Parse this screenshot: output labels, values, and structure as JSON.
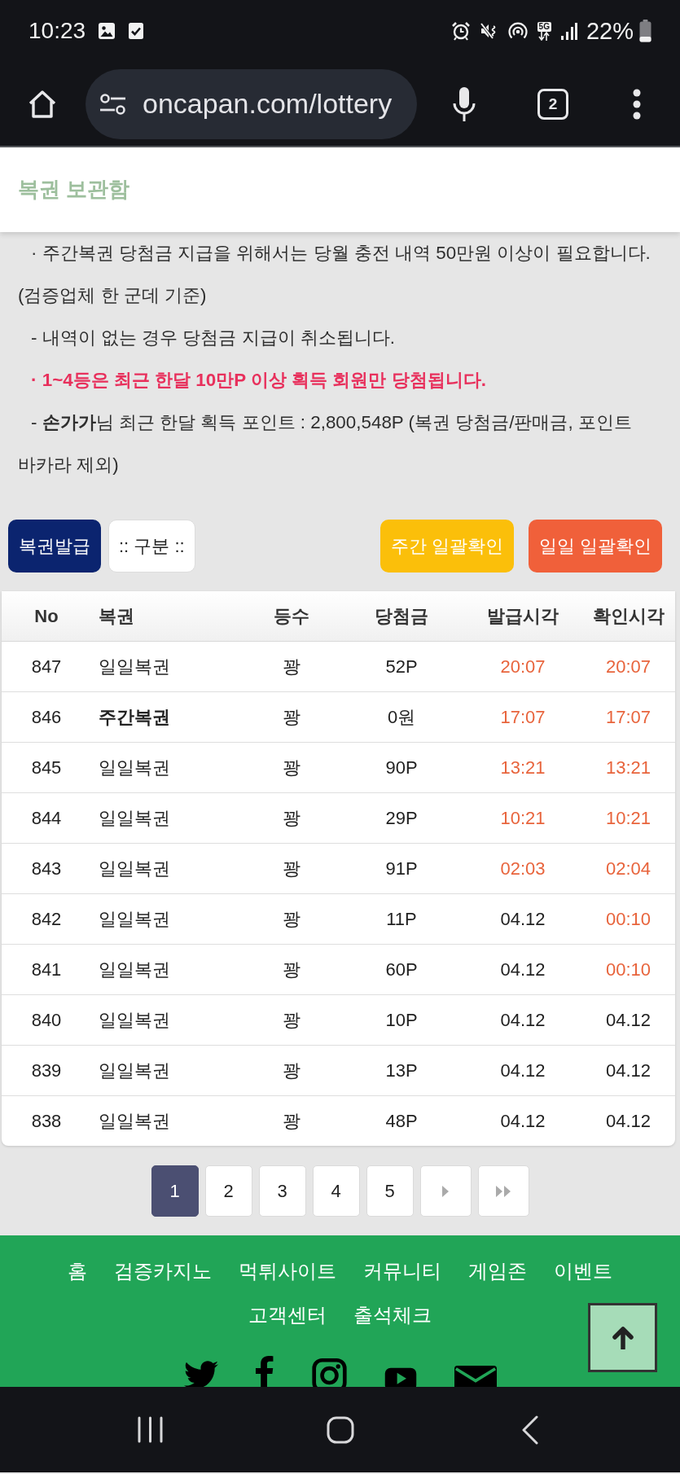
{
  "status_bar": {
    "time": "10:23",
    "network": "5G",
    "battery": "22%"
  },
  "browser": {
    "url": "oncapan.com/lottery",
    "tab_count": "2"
  },
  "header": {
    "title": "복권 보관함"
  },
  "notices": [
    {
      "text": "· 주간복권 당첨금 지급을 위해서는 당월 충전 내역 50만원 이상이 필요합니다. (검증업체 한 군데 기준)",
      "highlight": false
    },
    {
      "text": "- 내역이 없는 경우 당첨금 지급이 취소됩니다.",
      "highlight": false
    },
    {
      "text": "· 1~4등은 최근 한달 10만P 이상 획득 회원만 당첨됩니다.",
      "highlight": true
    },
    {
      "text": "- **손가가**님 최근 한달 획득 포인트 : 2,800,548P (복권 당첨금/판매금, 포인트 바카라 제외)",
      "highlight": false
    }
  ],
  "toolbar": {
    "left": [
      {
        "label": "복권발급",
        "kind": "issue"
      },
      {
        "label": ":: 구분 ::",
        "kind": "select"
      }
    ],
    "right": [
      {
        "label": "주간 일괄확인",
        "kind": "weekly"
      },
      {
        "label": "일일 일괄확인",
        "kind": "daily"
      }
    ]
  },
  "table": {
    "columns": [
      "No",
      "복권",
      "등수",
      "당첨금",
      "발급시각",
      "확인시각"
    ],
    "rows": [
      {
        "no": "847",
        "lottery": "일일복권",
        "emphasized": false,
        "rank": "꽝",
        "prize": "52P",
        "issued_at": {
          "text": "20:07",
          "highlighted": true
        },
        "checked_at": {
          "text": "20:07",
          "highlighted": true
        }
      },
      {
        "no": "846",
        "lottery": "주간복권",
        "emphasized": true,
        "rank": "꽝",
        "prize": "0원",
        "issued_at": {
          "text": "17:07",
          "highlighted": true
        },
        "checked_at": {
          "text": "17:07",
          "highlighted": true
        }
      },
      {
        "no": "845",
        "lottery": "일일복권",
        "emphasized": false,
        "rank": "꽝",
        "prize": "90P",
        "issued_at": {
          "text": "13:21",
          "highlighted": true
        },
        "checked_at": {
          "text": "13:21",
          "highlighted": true
        }
      },
      {
        "no": "844",
        "lottery": "일일복권",
        "emphasized": false,
        "rank": "꽝",
        "prize": "29P",
        "issued_at": {
          "text": "10:21",
          "highlighted": true
        },
        "checked_at": {
          "text": "10:21",
          "highlighted": true
        }
      },
      {
        "no": "843",
        "lottery": "일일복권",
        "emphasized": false,
        "rank": "꽝",
        "prize": "91P",
        "issued_at": {
          "text": "02:03",
          "highlighted": true
        },
        "checked_at": {
          "text": "02:04",
          "highlighted": true
        }
      },
      {
        "no": "842",
        "lottery": "일일복권",
        "emphasized": false,
        "rank": "꽝",
        "prize": "11P",
        "issued_at": {
          "text": "04.12",
          "highlighted": false
        },
        "checked_at": {
          "text": "00:10",
          "highlighted": true
        }
      },
      {
        "no": "841",
        "lottery": "일일복권",
        "emphasized": false,
        "rank": "꽝",
        "prize": "60P",
        "issued_at": {
          "text": "04.12",
          "highlighted": false
        },
        "checked_at": {
          "text": "00:10",
          "highlighted": true
        }
      },
      {
        "no": "840",
        "lottery": "일일복권",
        "emphasized": false,
        "rank": "꽝",
        "prize": "10P",
        "issued_at": {
          "text": "04.12",
          "highlighted": false
        },
        "checked_at": {
          "text": "04.12",
          "highlighted": false
        }
      },
      {
        "no": "839",
        "lottery": "일일복권",
        "emphasized": false,
        "rank": "꽝",
        "prize": "13P",
        "issued_at": {
          "text": "04.12",
          "highlighted": false
        },
        "checked_at": {
          "text": "04.12",
          "highlighted": false
        }
      },
      {
        "no": "838",
        "lottery": "일일복권",
        "emphasized": false,
        "rank": "꽝",
        "prize": "48P",
        "issued_at": {
          "text": "04.12",
          "highlighted": false
        },
        "checked_at": {
          "text": "04.12",
          "highlighted": false
        }
      }
    ]
  },
  "pagination": {
    "pages": [
      {
        "label": "1",
        "selected": true
      },
      {
        "label": "2",
        "selected": false
      },
      {
        "label": "3",
        "selected": false
      },
      {
        "label": "4",
        "selected": false
      },
      {
        "label": "5",
        "selected": false
      }
    ]
  },
  "footer": {
    "links": [
      "홈",
      "검증카지노",
      "먹튀사이트",
      "커뮤니티",
      "게임존",
      "이벤트",
      "고객센터",
      "출석체크"
    ]
  }
}
